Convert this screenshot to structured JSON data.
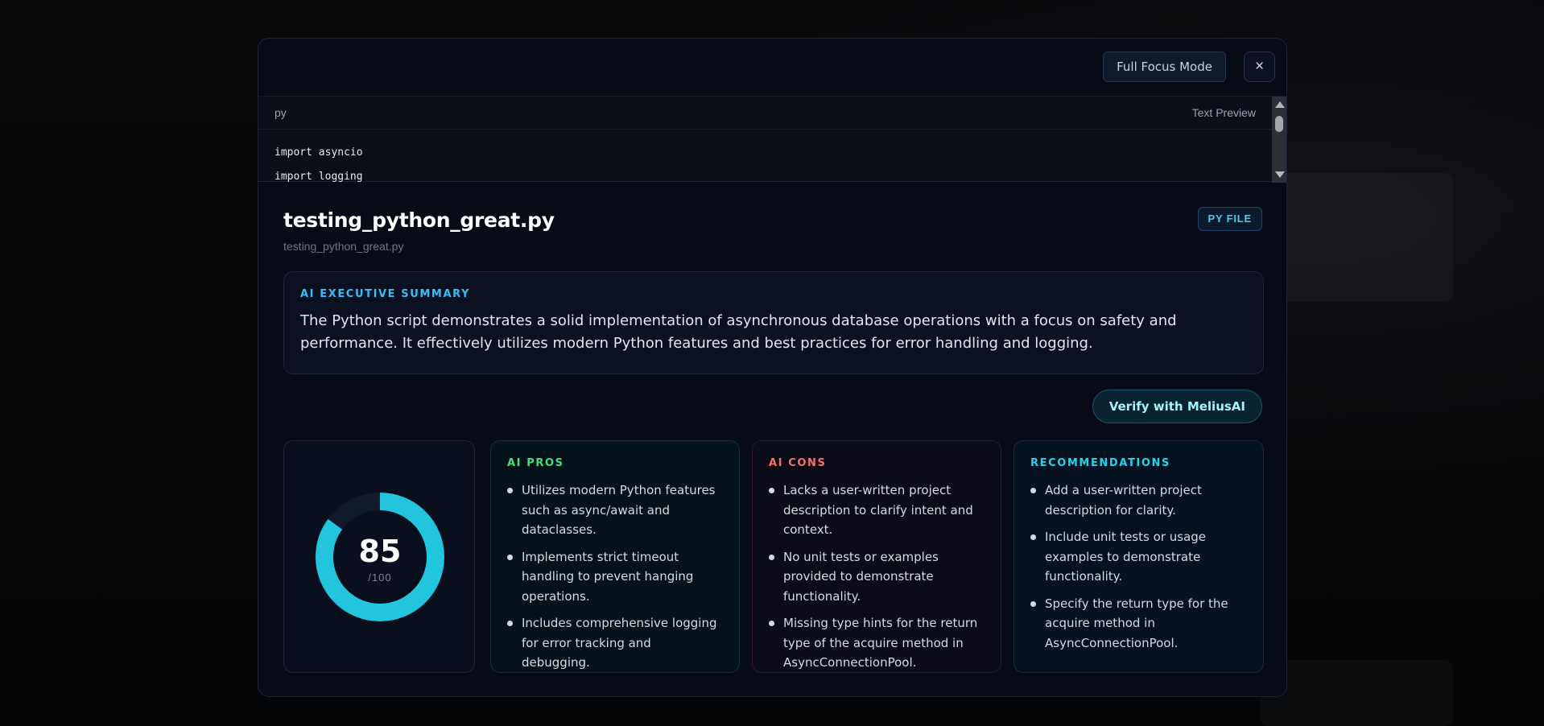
{
  "toolbar": {
    "focus_label": "Full Focus Mode",
    "close_label": "×"
  },
  "preview": {
    "language": "py",
    "mode_label": "Text Preview",
    "code_lines": [
      "import asyncio",
      "import logging"
    ]
  },
  "file": {
    "title": "testing_python_great.py",
    "subtitle": "testing_python_great.py",
    "badge": "PY FILE"
  },
  "summary": {
    "label": "AI EXECUTIVE SUMMARY",
    "text": "The Python script demonstrates a solid implementation of asynchronous database operations with a focus on safety and performance. It effectively utilizes modern Python features and best practices for error handling and logging."
  },
  "verify_label": "Verify with MeliusAI",
  "score": {
    "value": 85,
    "max_label": "/100",
    "fraction": 0.85,
    "ring_color": "#22c5dd",
    "track_color": "#111a2b"
  },
  "pros": {
    "label": "AI PROS",
    "items": [
      "Utilizes modern Python features such as async/await and dataclasses.",
      "Implements strict timeout handling to prevent hanging operations.",
      "Includes comprehensive logging for error tracking and debugging."
    ]
  },
  "cons": {
    "label": "AI CONS",
    "items": [
      "Lacks a user-written project description to clarify intent and context.",
      "No unit tests or examples provided to demonstrate functionality.",
      "Missing type hints for the return type of the acquire method in AsyncConnectionPool."
    ]
  },
  "recommendations": {
    "label": "RECOMMENDATIONS",
    "items": [
      "Add a user-written project description for clarity.",
      "Include unit tests or usage examples to demonstrate functionality.",
      "Specify the return type for the acquire method in AsyncConnectionPool."
    ]
  }
}
